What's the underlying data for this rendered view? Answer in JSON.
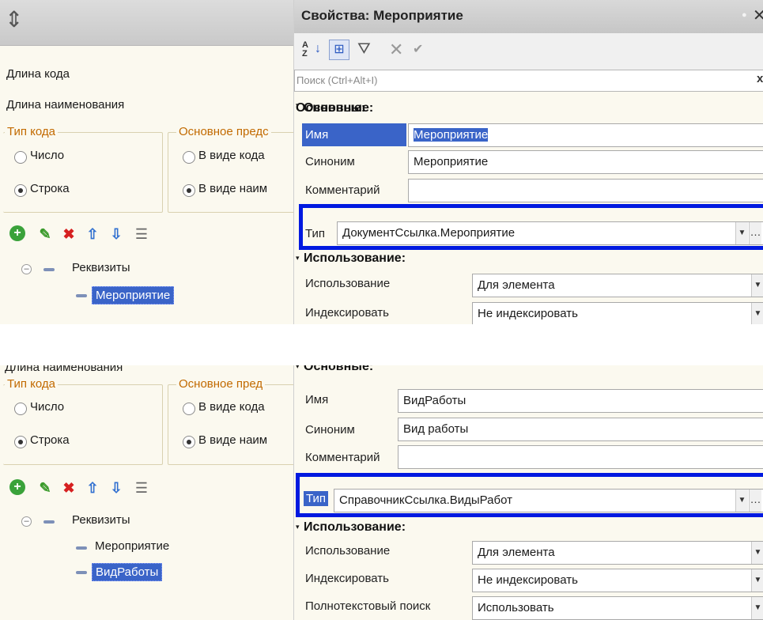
{
  "top": {
    "left": {
      "code_length_label": "Длина кода",
      "name_length_label": "Длина наименования",
      "code_type_group": "Тип кода",
      "code_type_number": "Число",
      "code_type_string": "Строка",
      "main_repr_group": "Основное предс",
      "repr_code": "В виде кода",
      "repr_name": "В виде наим",
      "tree_root": "Реквизиты",
      "tree_items": [
        "Мероприятие"
      ]
    },
    "props": {
      "title": "Свойства: Мероприятие",
      "search_placeholder": "Поиск (Ctrl+Alt+I)",
      "section_main": "Основные:",
      "name_label": "Имя",
      "name_value": "Мероприятие",
      "synonym_label": "Синоним",
      "synonym_value": "Мероприятие",
      "comment_label": "Комментарий",
      "comment_value": "",
      "type_label": "Тип",
      "type_value": "ДокументСсылка.Мероприятие",
      "section_usage": "Использование:",
      "usage_label": "Использование",
      "usage_value": "Для элемента",
      "index_label": "Индексировать",
      "index_value": "Не индексировать"
    }
  },
  "bottom": {
    "left": {
      "name_length_label": "Длина наименования",
      "code_type_group": "Тип кода",
      "code_type_number": "Число",
      "code_type_string": "Строка",
      "main_repr_group": "Основное пред",
      "repr_code": "В виде кода",
      "repr_name": "В виде наим",
      "tree_root": "Реквизиты",
      "tree_items": [
        "Мероприятие",
        "ВидРаботы"
      ]
    },
    "props": {
      "section_main": "Основные:",
      "name_label": "Имя",
      "name_value": "ВидРаботы",
      "synonym_label": "Синоним",
      "synonym_value": "Вид работы",
      "comment_label": "Комментарий",
      "comment_value": "",
      "type_label": "Тип",
      "type_value": "СправочникСсылка.ВидыРабот",
      "section_usage": "Использование:",
      "usage_label": "Использование",
      "usage_value": "Для элемента",
      "index_label": "Индексировать",
      "index_value": "Не индексировать",
      "fulltext_label": "Полнотекстовый поиск",
      "fulltext_value": "Использовать"
    }
  },
  "colors": {
    "highlight_border": "#0019e0",
    "selection": "#3a64c8",
    "group_label": "#c26a00",
    "panel_bg": "#fbf9ef"
  },
  "icons": [
    "resize-cursor-icon",
    "add-icon",
    "edit-icon",
    "delete-icon",
    "move-up-icon",
    "move-down-icon",
    "list-icon",
    "sort-az-icon",
    "categories-icon",
    "filter-icon",
    "close-icon",
    "check-icon",
    "pin-icon",
    "dropdown-arrow-icon"
  ]
}
